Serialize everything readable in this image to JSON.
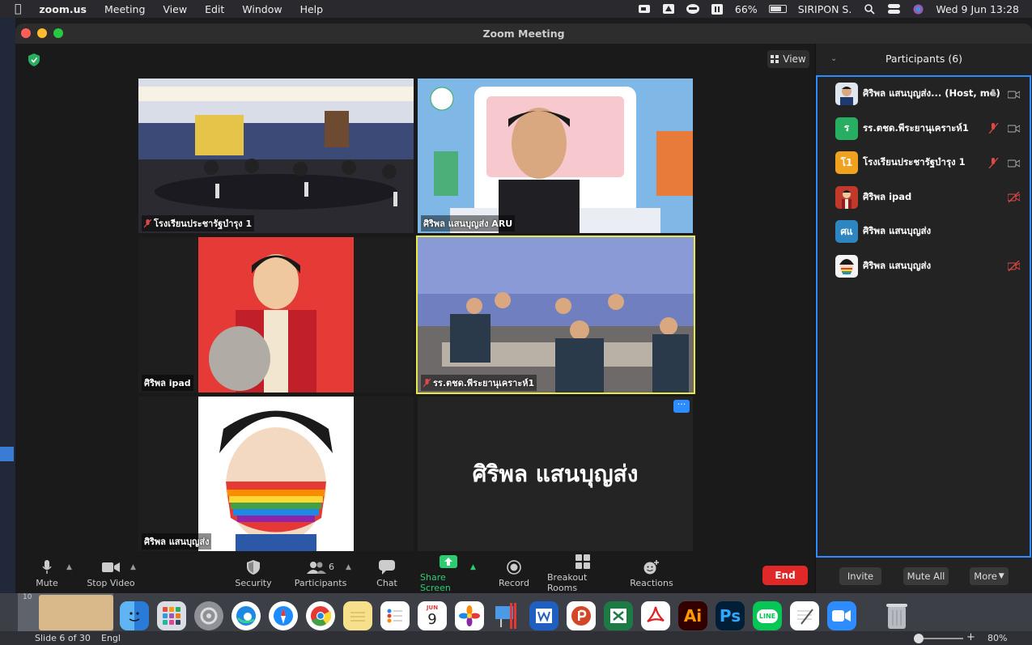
{
  "menubar": {
    "app": "zoom.us",
    "items": [
      "Meeting",
      "View",
      "Edit",
      "Window",
      "Help"
    ],
    "battery": "66%",
    "user": "SIRIPON S.",
    "datetime": "Wed 9 Jun  13:28"
  },
  "window": {
    "title": "Zoom Meeting",
    "view_label": "View"
  },
  "tiles": [
    {
      "label": "โรงเรียนประชารัฐบำรุง 1"
    },
    {
      "label": "ศิริพล แสนบุญส่ง ARU"
    },
    {
      "label": "ศิริพล ipad"
    },
    {
      "label": "รร.ตชด.พีระยานุเคราะห์1"
    },
    {
      "label": "ศิริพล แสนบุญส่ง"
    },
    {
      "big_name": "ศิริพล แสนบุญส่ง",
      "more": "···"
    }
  ],
  "colors": {
    "accent": "#2d8cff",
    "end": "#e02828",
    "share": "#2ecc71",
    "muted": "#e04848",
    "active_speaker": "#e8e84a"
  },
  "participants": {
    "title": "Participants (6)",
    "list": [
      {
        "name": "ศิริพล แสนบุญส่ง... (Host, me)",
        "initial": "",
        "color": "#dfe6ee"
      },
      {
        "name": "รร.ตชด.พีระยานุเคราะห์1",
        "initial": "ร",
        "color": "#27ae60"
      },
      {
        "name": "โรงเรียนประชารัฐบำรุง 1",
        "initial": "โ1",
        "color": "#f0a21e"
      },
      {
        "name": "ศิริพล ipad",
        "initial": "",
        "color": "#c0392b"
      },
      {
        "name": "ศิริพล แสนบุญส่ง",
        "initial": "ศแ",
        "color": "#2e86c1"
      },
      {
        "name": "ศิริพล แสนบุญส่ง",
        "initial": "",
        "color": "#f4f4f4"
      }
    ],
    "invite": "Invite",
    "mute_all": "Mute All",
    "more": "More"
  },
  "toolbar": {
    "mute": "Mute",
    "stop_video": "Stop Video",
    "security": "Security",
    "participants": "Participants",
    "participants_count": "6",
    "chat": "Chat",
    "share_screen": "Share Screen",
    "record": "Record",
    "breakout": "Breakout Rooms",
    "reactions": "Reactions",
    "end": "End"
  },
  "dock": {
    "calendar_month": "JUN",
    "calendar_day": "9",
    "ten": "10",
    "adobe_ai": "Ai",
    "adobe_ps": "Ps",
    "line": "LINE"
  },
  "statusbar": {
    "slide": "Slide 6 of 30",
    "lang": "Engl",
    "zoom": "80%"
  }
}
